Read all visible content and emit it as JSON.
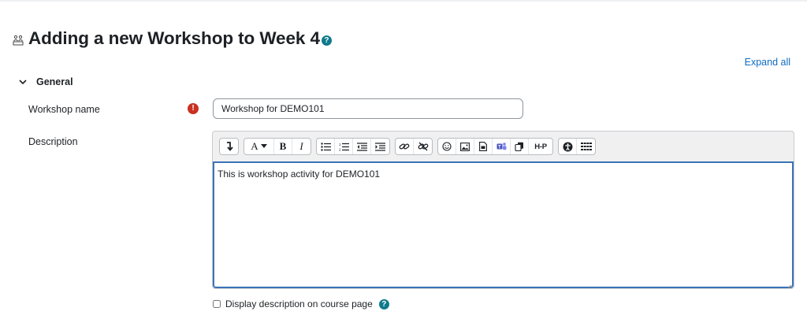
{
  "page": {
    "title": "Adding a new Workshop to Week 4",
    "expand_all": "Expand all"
  },
  "section": {
    "label": "General"
  },
  "form": {
    "name_label": "Workshop name",
    "name_value": "Workshop for DEMO101",
    "description_label": "Description",
    "description_value": "This is workshop activity for DEMO101",
    "show_description_label": "Display description on course page",
    "show_description_checked": false
  },
  "toolbar": {
    "groups": [
      [
        "collapse-icon"
      ],
      [
        "font-style-dropdown-icon",
        "bold-icon",
        "italic-icon"
      ],
      [
        "unordered-list-icon",
        "ordered-list-icon",
        "outdent-icon",
        "indent-icon"
      ],
      [
        "link-icon",
        "unlink-icon"
      ],
      [
        "emoji-icon",
        "image-icon",
        "media-icon",
        "teams-icon",
        "copy-icon",
        "h5p-icon"
      ],
      [
        "accessibility-checker-icon",
        "screen-reader-helper-icon"
      ]
    ],
    "labels": {
      "bold": "B",
      "italic": "I",
      "font_style": "A",
      "h5p": "H-P"
    }
  },
  "colors": {
    "accent": "#0f6cbf",
    "required": "#ca3120",
    "editor_focus": "#3b73b8",
    "help": "#0f7a8c"
  }
}
